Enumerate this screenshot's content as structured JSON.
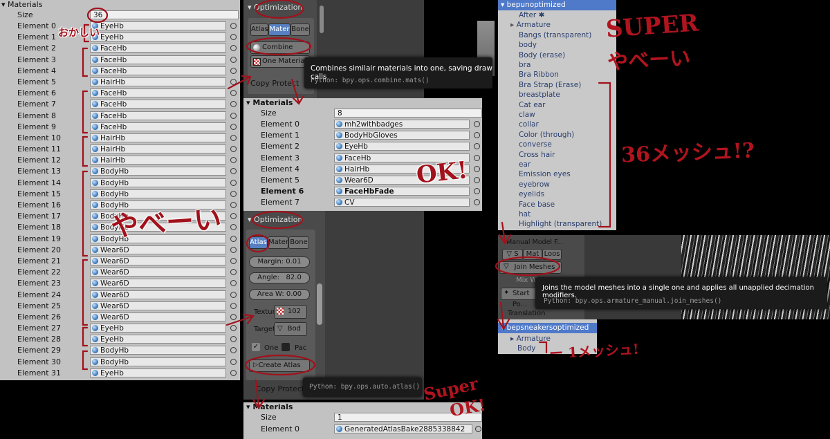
{
  "left_panel": {
    "header": "Materials",
    "size_label": "Size",
    "size_value": "36",
    "rows": [
      {
        "label": "Element 0",
        "value": "EyeHb"
      },
      {
        "label": "Element 1",
        "value": "EyeHb"
      },
      {
        "label": "Element 2",
        "value": "FaceHb"
      },
      {
        "label": "Element 3",
        "value": "FaceHb"
      },
      {
        "label": "Element 4",
        "value": "FaceHb"
      },
      {
        "label": "Element 5",
        "value": "HairHb"
      },
      {
        "label": "Element 6",
        "value": "FaceHb"
      },
      {
        "label": "Element 7",
        "value": "FaceHb"
      },
      {
        "label": "Element 8",
        "value": "FaceHb"
      },
      {
        "label": "Element 9",
        "value": "FaceHb"
      },
      {
        "label": "Element 10",
        "value": "HairHb"
      },
      {
        "label": "Element 11",
        "value": "HairHb"
      },
      {
        "label": "Element 12",
        "value": "HairHb"
      },
      {
        "label": "Element 13",
        "value": "BodyHb"
      },
      {
        "label": "Element 14",
        "value": "BodyHb"
      },
      {
        "label": "Element 15",
        "value": "BodyHb"
      },
      {
        "label": "Element 16",
        "value": "BodyHb"
      },
      {
        "label": "Element 17",
        "value": "BodyHb"
      },
      {
        "label": "Element 18",
        "value": "BodyHb"
      },
      {
        "label": "Element 19",
        "value": "BodyHb"
      },
      {
        "label": "Element 20",
        "value": "Wear6D"
      },
      {
        "label": "Element 21",
        "value": "Wear6D"
      },
      {
        "label": "Element 22",
        "value": "Wear6D"
      },
      {
        "label": "Element 23",
        "value": "Wear6D"
      },
      {
        "label": "Element 24",
        "value": "Wear6D"
      },
      {
        "label": "Element 25",
        "value": "Wear6D"
      },
      {
        "label": "Element 26",
        "value": "Wear6D"
      },
      {
        "label": "Element 27",
        "value": "EyeHb"
      },
      {
        "label": "Element 28",
        "value": "EyeHb"
      },
      {
        "label": "Element 29",
        "value": "BodyHb"
      },
      {
        "label": "Element 30",
        "value": "BodyHb"
      },
      {
        "label": "Element 31",
        "value": "EyeHb"
      }
    ]
  },
  "opt_top": {
    "title": "Optimization",
    "tabs": [
      "Atlas",
      "Mater",
      "Bone"
    ],
    "combine_label": "Combine Sa...",
    "one_material_label": "One Material",
    "copy_label": "Copy Protect"
  },
  "tooltip_combine": {
    "text": "Combines similair materials into one, saving draw calls",
    "python": "Python: bpy.ops.combine.mats()"
  },
  "mid_materials": {
    "header": "Materials",
    "size_label": "Size",
    "size_value": "8",
    "rows": [
      {
        "label": "Element 0",
        "value": "mh2withbadges"
      },
      {
        "label": "Element 1",
        "value": "BodyHbGloves"
      },
      {
        "label": "Element 2",
        "value": "EyeHb"
      },
      {
        "label": "Element 3",
        "value": "FaceHb"
      },
      {
        "label": "Element 4",
        "value": "HairHb"
      },
      {
        "label": "Element 5",
        "value": "Wear6D"
      },
      {
        "label": "Element 6",
        "value": "FaceHbFade"
      },
      {
        "label": "Element 7",
        "value": "CV"
      }
    ]
  },
  "opt_atlas": {
    "title": "Optimization",
    "tabs": [
      "Atlas",
      "Mater",
      "Bone"
    ],
    "margin": "Margin:  0.01",
    "angle_label": "Angle:",
    "angle_value": "82.0",
    "area": "Area W:  0.00",
    "texture_label": "Textur",
    "texture_value": "102",
    "target_label": "Target",
    "target_value": "Bod",
    "one_label": "One",
    "pack_label": "Pac",
    "create_atlas_label": "Create Atlas",
    "copy_label": "Copy Protectio"
  },
  "tooltip_atlas": {
    "python": "Python: bpy.ops.auto.atlas()"
  },
  "bottom_materials": {
    "header": "Materials",
    "size_label": "Size",
    "size_value": "1",
    "row_label": "Element 0",
    "row_value": "GeneratedAtlasBake2885338842"
  },
  "outliner_unopt": {
    "title": "bepunoptimized",
    "items": [
      "After",
      "Armature",
      "Bangs (transparent)",
      "body",
      "Body (erase)",
      "bra",
      "Bra Ribbon",
      "Bra Strap (Erase)",
      "breastplate",
      "Cat ear",
      "claw",
      "collar",
      "Color (through)",
      "converse",
      "Cross hair",
      "ear",
      "Emission eyes",
      "eyebrow",
      "eyelids",
      "Face base",
      "hat",
      "Highlight (transparent)"
    ]
  },
  "manual_model": {
    "title": "Manual Model F...",
    "tabs": [
      "S",
      "Mat",
      "Loos"
    ],
    "join_label": "Join Meshes",
    "mix_label": "Mix W...",
    "start_label": "Start Po...",
    "translation_label": "Translation"
  },
  "tooltip_join": {
    "text": "Joins the model meshes into a single one and applies all unapplied decimation modifiers.",
    "python": "Python: bpy.ops.armature_manual.join_meshes()"
  },
  "outliner_opt": {
    "title": "bepsneakersoptimized",
    "items": [
      "Armature",
      "Body"
    ]
  },
  "annotations": {
    "okashii": "おかしい",
    "yabai": "やべーい",
    "ok1": "OK!",
    "super_top": "SUPER",
    "yabai_top": "やべーい",
    "count36": "36メッシュ!?",
    "one_mesh": "ー 1メッシュ!",
    "super_ok_1": "Super",
    "super_ok_2": "OK!"
  },
  "colors": {
    "annotation": "#a1121c",
    "selected": "#5680c2",
    "outliner_header": "#4f79c9"
  }
}
